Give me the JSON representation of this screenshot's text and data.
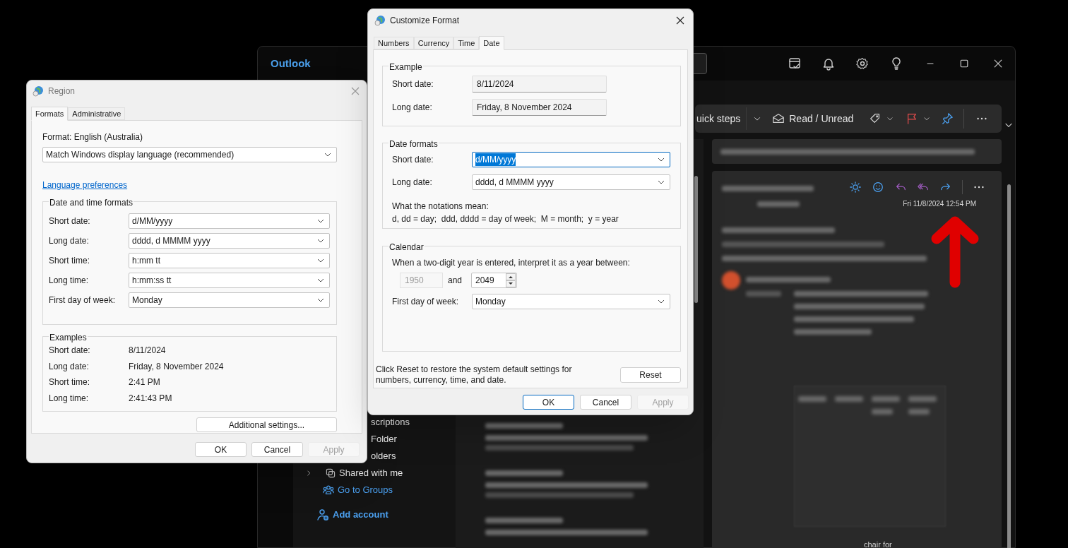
{
  "outlook": {
    "title": "Outlook",
    "toolbar": [
      {
        "kind": "split",
        "label": "uick steps"
      },
      {
        "kind": "envelope",
        "label": "Read / Unread"
      }
    ],
    "date": "Fri 11/8/2024 12:54 PM",
    "nav_items": [
      {
        "kind": "plain",
        "label": "scriptions"
      },
      {
        "kind": "plain",
        "label": "Folder"
      },
      {
        "kind": "plain",
        "label": "olders"
      },
      {
        "kind": "shared",
        "label": "Shared with me"
      },
      {
        "kind": "groups",
        "label": "Go to Groups"
      },
      {
        "kind": "add",
        "label": "Add account"
      }
    ],
    "table_snippet": "chair for"
  },
  "region": {
    "title": "Region",
    "tabs": [
      {
        "label": "Formats",
        "selected": true
      },
      {
        "label": "Administrative",
        "selected": false
      }
    ],
    "format_label": "Format: English (Australia)",
    "format_value": "Match Windows display language (recommended)",
    "link": "Language preferences",
    "group_title": "Date and time formats",
    "fields": [
      {
        "label": "Short date:",
        "value": "d/MM/yyyy"
      },
      {
        "label": "Long date:",
        "value": "dddd, d MMMM yyyy"
      },
      {
        "label": "Short time:",
        "value": "h:mm tt"
      },
      {
        "label": "Long time:",
        "value": "h:mm:ss tt"
      },
      {
        "label": "First day of week:",
        "value": "Monday"
      }
    ],
    "examples_title": "Examples",
    "examples": [
      {
        "label": "Short date:",
        "value": "8/11/2024"
      },
      {
        "label": "Long date:",
        "value": "Friday, 8 November 2024"
      },
      {
        "label": "Short time:",
        "value": "2:41 PM"
      },
      {
        "label": "Long time:",
        "value": "2:41:43 PM"
      }
    ],
    "additional_button": "Additional settings...",
    "buttons": [
      {
        "label": "OK",
        "default": false,
        "disabled": false
      },
      {
        "label": "Cancel",
        "default": false,
        "disabled": false
      },
      {
        "label": "Apply",
        "default": false,
        "disabled": true
      }
    ]
  },
  "customize": {
    "title": "Customize Format",
    "tabs": [
      {
        "label": "Numbers",
        "selected": false
      },
      {
        "label": "Currency",
        "selected": false
      },
      {
        "label": "Time",
        "selected": false
      },
      {
        "label": "Date",
        "selected": true
      }
    ],
    "example_title": "Example",
    "examples": [
      {
        "label": "Short date:",
        "value": "8/11/2024"
      },
      {
        "label": "Long date:",
        "value": "Friday, 8 November 2024"
      }
    ],
    "formats_title": "Date formats",
    "formats": [
      {
        "label": "Short date:",
        "value": "d/MM/yyyy",
        "focused": true
      },
      {
        "label": "Long date:",
        "value": "dddd, d MMMM yyyy",
        "focused": false
      }
    ],
    "notation_title": "What the notations mean:",
    "notation": "d, dd = day;  ddd, dddd = day of week;  M = month;  y = year",
    "calendar_title": "Calendar",
    "calendar_prompt": "When a two-digit year is entered, interpret it as a year between:",
    "year_from": "1950",
    "year_and": "and",
    "year_to": "2049",
    "first_day_label": "First day of week:",
    "first_day_value": "Monday",
    "reset_note": "Click Reset to restore the system default settings for numbers, currency, time, and date.",
    "reset_button": "Reset",
    "buttons": [
      {
        "label": "OK",
        "default": true,
        "disabled": false
      },
      {
        "label": "Cancel",
        "default": false,
        "disabled": false
      },
      {
        "label": "Apply",
        "default": false,
        "disabled": true
      }
    ]
  }
}
